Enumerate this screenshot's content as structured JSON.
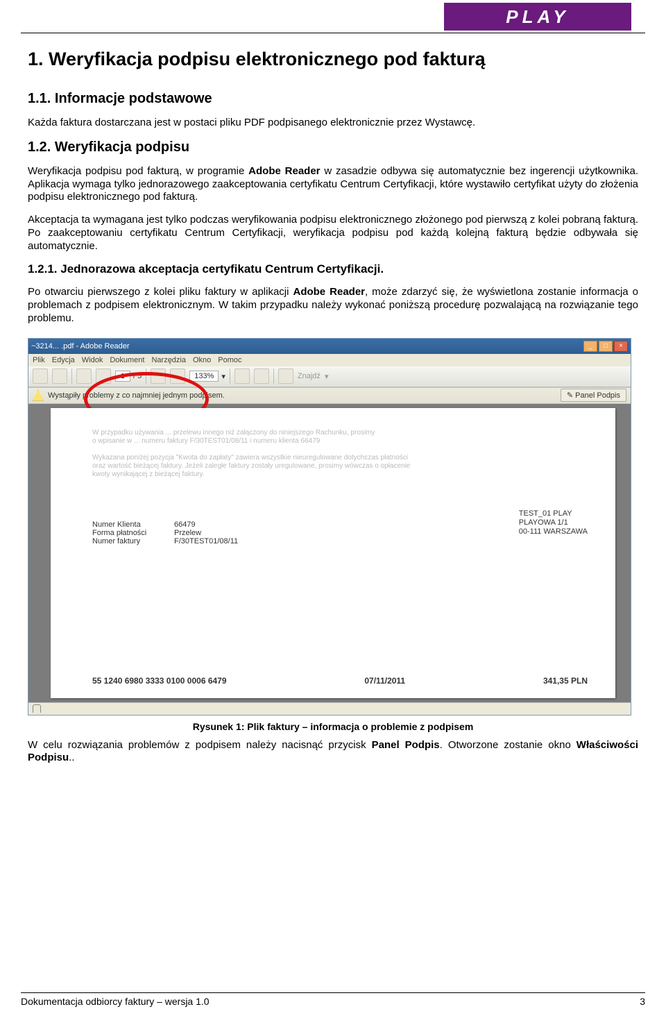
{
  "header": {
    "brand": "PLAY"
  },
  "h1": "1. Weryfikacja podpisu elektronicznego pod fakturą",
  "s11": {
    "title": "1.1. Informacje podstawowe",
    "p": "Każda faktura dostarczana jest w postaci pliku PDF podpisanego elektronicznie przez Wystawcę."
  },
  "s12": {
    "title": "1.2. Weryfikacja podpisu",
    "p1a": "Weryfikacja podpisu pod fakturą, w programie ",
    "p1b": "Adobe Reader",
    "p1c": " w zasadzie odbywa się automatycznie bez ingerencji użytkownika. Aplikacja wymaga tylko jednorazowego zaakceptowania certyfikatu Centrum Certyfikacji, które wystawiło certyfikat użyty do złożenia podpisu elektronicznego pod fakturą.",
    "p2": "Akceptacja ta wymagana jest tylko podczas weryfikowania podpisu elektronicznego złożonego pod pierwszą z kolei pobraną fakturą. Po zaakceptowaniu certyfikatu Centrum Certyfikacji, weryfikacja podpisu pod każdą kolejną fakturą będzie odbywała się automatycznie."
  },
  "s121": {
    "title": "1.2.1. Jednorazowa akceptacja certyfikatu Centrum Certyfikacji.",
    "p1a": "Po otwarciu pierwszego z kolei pliku faktury w aplikacji ",
    "p1b": "Adobe Reader",
    "p1c": ", może zdarzyć się, że wyświetlona zostanie informacja o problemach z podpisem elektronicznym. W takim przypadku należy wykonać poniższą procedurę pozwalającą na rozwiązanie tego problemu."
  },
  "screenshot": {
    "title": "~3214... .pdf - Adobe Reader",
    "menus": [
      "Plik",
      "Edycja",
      "Widok",
      "Dokument",
      "Narzędzia",
      "Okno",
      "Pomoc"
    ],
    "page_cur": "1",
    "page_total": "/ 5",
    "zoom": "133%",
    "find_label": "Znajdź",
    "sig_warning": "Wystąpiły problemy z co najmniej jednym podpisem.",
    "panel_btn": "Panel Podpis",
    "faint1": "W przypadku używania ... przelewu innego niż załączony do niniejszego Rachunku, prosimy",
    "faint2": "o wpisanie w ... numeru faktury F/30TEST01/08/11 i numeru klienta 66479",
    "faint3": "Wykazana poniżej pozycja \"Kwota do zapłaty\" zawiera wszystkie nieuregulowane dotychczas płatności",
    "faint4": "oraz wartość bieżącej faktury. Jeżeli zaległe faktury zostały uregulowane, prosimy wówczas o opłacenie",
    "faint5": "kwoty wynikającej z bieżącej faktury.",
    "kv": {
      "k1": "Numer Klienta",
      "v1": "66479",
      "k2": "Forma płatności",
      "v2": "Przelew",
      "k3": "Numer faktury",
      "v3": "F/30TEST01/08/11"
    },
    "addr": {
      "l1": "TEST_01 PLAY",
      "l2": "PLAYOWA 1/1",
      "l3": "00-111 WARSZAWA"
    },
    "bottom": {
      "acct": "55 1240 6980 3333 0100 0006 6479",
      "date": "07/11/2011",
      "amount": "341,35 PLN"
    }
  },
  "caption": "Rysunek 1: Plik faktury – informacja o problemie z podpisem",
  "after": {
    "a": "W celu rozwiązania problemów z podpisem należy nacisnąć przycisk ",
    "b": "Panel Podpis",
    "c": ". Otworzone zostanie okno ",
    "d": "Właściwości Podpisu",
    "e": ".."
  },
  "footer": {
    "left": "Dokumentacja odbiorcy faktury – wersja 1.0",
    "right": "3"
  }
}
